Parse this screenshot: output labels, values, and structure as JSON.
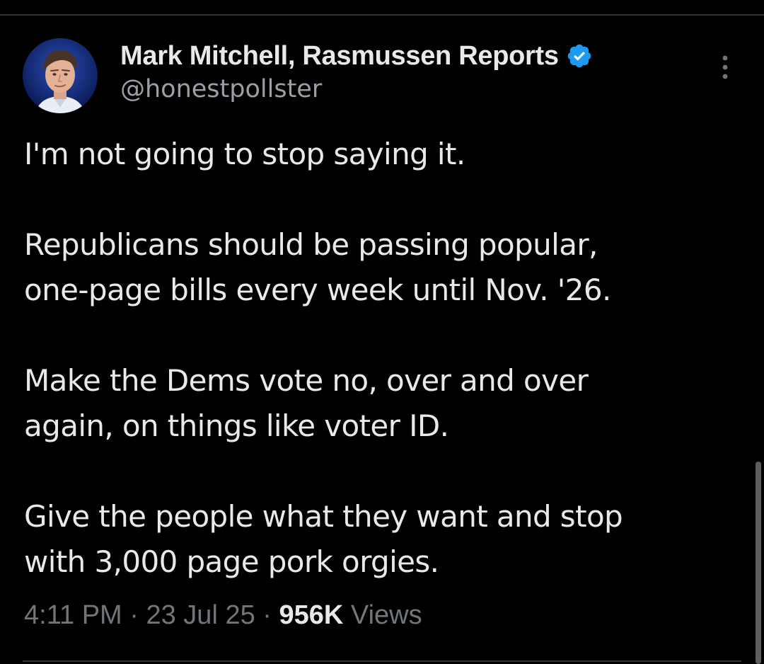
{
  "post": {
    "author": {
      "display_name": "Mark Mitchell, Rasmussen Reports",
      "handle": "@honestpollster",
      "verified": true,
      "avatar_icon": "profile-photo"
    },
    "paragraphs": [
      "I'm not going to stop saying it.",
      "Republicans should be passing popular,\none-page bills every week until Nov. '26.",
      "Make the Dems vote no, over and over\nagain, on things like voter ID.",
      "Give the people what they want and stop\nwith 3,000 page pork orgies."
    ],
    "meta": {
      "time": "4:11 PM",
      "separator": " · ",
      "date": "23 Jul 25",
      "views_count": "956K",
      "views_label": "Views"
    }
  },
  "icons": {
    "verified": "verified-badge-icon",
    "more": "more-options-icon"
  },
  "colors": {
    "background": "#000000",
    "text_primary": "#e7e9ea",
    "text_secondary": "#71767b",
    "verified_blue": "#1d9bf0",
    "divider": "#2f3336"
  }
}
